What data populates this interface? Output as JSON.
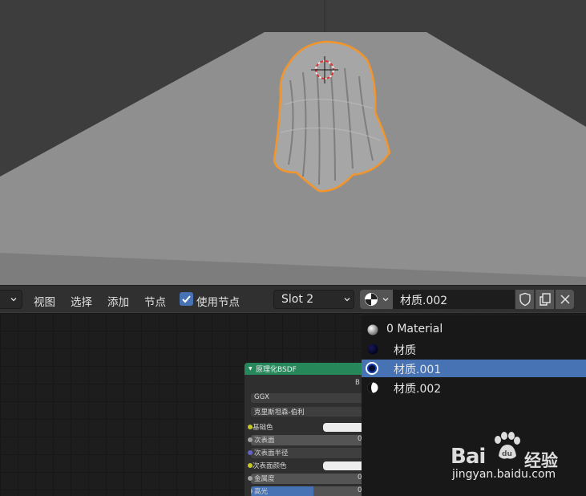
{
  "viewport": {},
  "header": {
    "menus": [
      "视图",
      "选择",
      "添加",
      "节点"
    ],
    "use_nodes_label": "使用节点",
    "use_nodes_checked": true,
    "slot_value": "Slot 2",
    "material_name": "材质.002"
  },
  "node": {
    "title": "原理化BSDF",
    "output_label": "B",
    "distribution": "GGX",
    "subsurface_method": "克里斯坦森-伯利",
    "rows": [
      {
        "label": "基础色",
        "value": ""
      },
      {
        "label": "次表面",
        "value": "0."
      },
      {
        "label": "次表面半径",
        "value": ""
      },
      {
        "label": "次表面颜色",
        "value": ""
      },
      {
        "label": "金属度",
        "value": "0."
      },
      {
        "label": "高光",
        "value": "0."
      }
    ]
  },
  "material_popup": {
    "items": [
      {
        "label": "0 Material",
        "selected": false
      },
      {
        "label": "材质",
        "selected": false
      },
      {
        "label": "材质.001",
        "selected": true
      },
      {
        "label": "材质.002",
        "selected": false
      }
    ],
    "accent_color": "#4772b3"
  },
  "watermark": {
    "logo": "Bai",
    "logo2": "du",
    "cn": "经验",
    "url": "jingyan.baidu.com"
  }
}
